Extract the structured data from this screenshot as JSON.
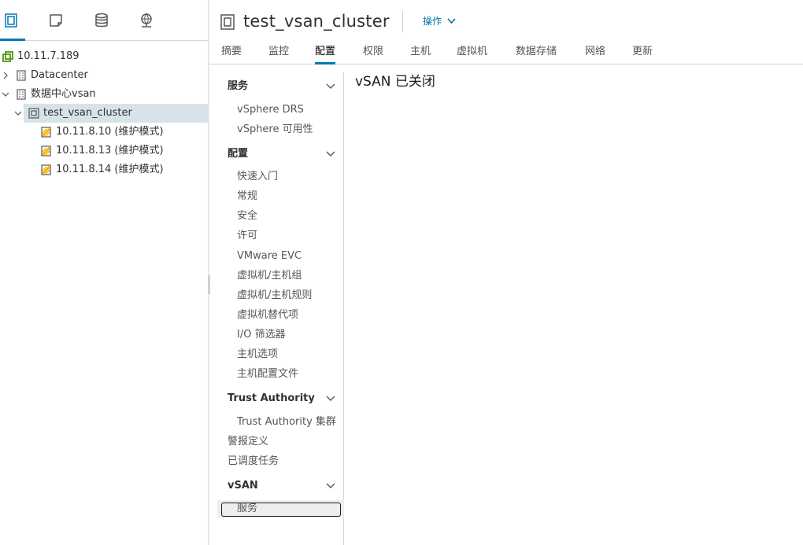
{
  "navigator": {
    "tabs": [
      {
        "icon": "hosts-clusters-icon",
        "active": true
      },
      {
        "icon": "vms-templates-icon",
        "active": false
      },
      {
        "icon": "storage-icon",
        "active": false
      },
      {
        "icon": "networking-icon",
        "active": false
      }
    ],
    "tree": [
      {
        "label": "10.11.7.189",
        "icon": "vcenter-icon",
        "expanded": false
      },
      {
        "label": "Datacenter",
        "icon": "datacenter-icon",
        "expanded": false
      },
      {
        "label": "数据中心vsan",
        "icon": "datacenter-icon",
        "expanded": true
      },
      {
        "label": "test_vsan_cluster",
        "icon": "cluster-icon",
        "expanded": true,
        "selected": true
      },
      {
        "label": "10.11.8.10 (维护模式)",
        "icon": "host-maintenance-icon"
      },
      {
        "label": "10.11.8.13 (维护模式)",
        "icon": "host-maintenance-icon"
      },
      {
        "label": "10.11.8.14 (维护模式)",
        "icon": "host-maintenance-icon"
      }
    ]
  },
  "header": {
    "title": "test_vsan_cluster",
    "actions_label": "操作"
  },
  "tabs": [
    "摘要",
    "监控",
    "配置",
    "权限",
    "主机",
    "虚拟机",
    "数据存储",
    "网络",
    "更新"
  ],
  "active_tab": "配置",
  "subnav": {
    "groups": [
      {
        "label": "服务",
        "items": [
          "vSphere DRS",
          "vSphere 可用性"
        ]
      },
      {
        "label": "配置",
        "items": [
          "快速入门",
          "常规",
          "安全",
          "许可",
          "VMware EVC",
          "虚拟机/主机组",
          "虚拟机/主机规则",
          "虚拟机替代项",
          "I/O 筛选器",
          "主机选项",
          "主机配置文件"
        ]
      },
      {
        "label": "Trust Authority",
        "items": [
          "Trust Authority 集群"
        ]
      },
      {
        "label": "vSAN",
        "items": [
          "服务"
        ]
      }
    ],
    "top_items": [
      "警报定义",
      "已调度任务"
    ],
    "current": "服务"
  },
  "content": {
    "title": "vSAN 已关闭"
  },
  "colors": {
    "accent": "#0079b8",
    "link": "#0072a3",
    "selection": "#d8e3e9",
    "vcenter_green": "#5aa220",
    "maintenance_yellow": "#f5b301"
  }
}
